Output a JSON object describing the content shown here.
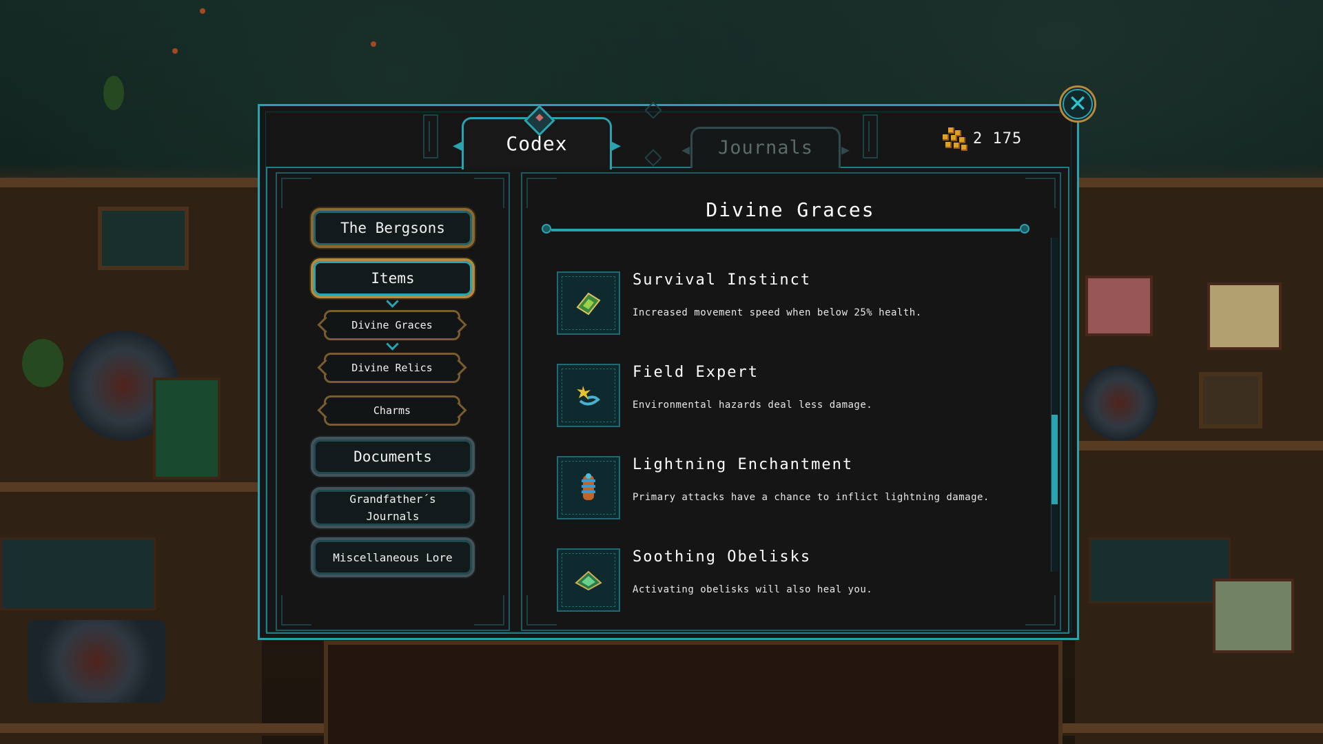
{
  "tabs": [
    {
      "label": "Codex",
      "active": true
    },
    {
      "label": "Journals",
      "active": false
    }
  ],
  "currency": {
    "amount": "2 175",
    "icon": "gold-nugget-icon"
  },
  "close": {
    "icon": "close-x-icon"
  },
  "nav": {
    "items": [
      {
        "label": "The Bergsons",
        "style": "gold"
      },
      {
        "label": "Items",
        "style": "gold-active",
        "expanded": true
      },
      {
        "label": "Divine Graces",
        "style": "sub",
        "selected": true
      },
      {
        "label": "Divine Relics",
        "style": "sub"
      },
      {
        "label": "Charms",
        "style": "sub"
      },
      {
        "label": "Documents",
        "style": "silver"
      },
      {
        "label": "Grandfather´s Journals",
        "line1": "Grandfather´s",
        "line2": "Journals",
        "style": "silver"
      },
      {
        "label": "Miscellaneous Lore",
        "style": "silver"
      }
    ]
  },
  "detail": {
    "title": "Divine Graces",
    "entries": [
      {
        "name": "Survival Instinct",
        "description": "Increased movement speed when below 25% health.",
        "icon": "winged-boot-icon"
      },
      {
        "name": "Field Expert",
        "description": "Environmental hazards deal less damage.",
        "icon": "spark-hazard-icon"
      },
      {
        "name": "Lightning Enchantment",
        "description": "Primary attacks have a chance to inflict lightning damage.",
        "icon": "lightning-coil-icon"
      },
      {
        "name": "Soothing Obelisks",
        "description": "Activating obelisks will also heal you.",
        "icon": "obelisk-icon"
      }
    ]
  },
  "colors": {
    "accent": "#2aa3b0",
    "gold": "#b48a3e",
    "panel": "#161616",
    "coin": "#e0a21e"
  }
}
